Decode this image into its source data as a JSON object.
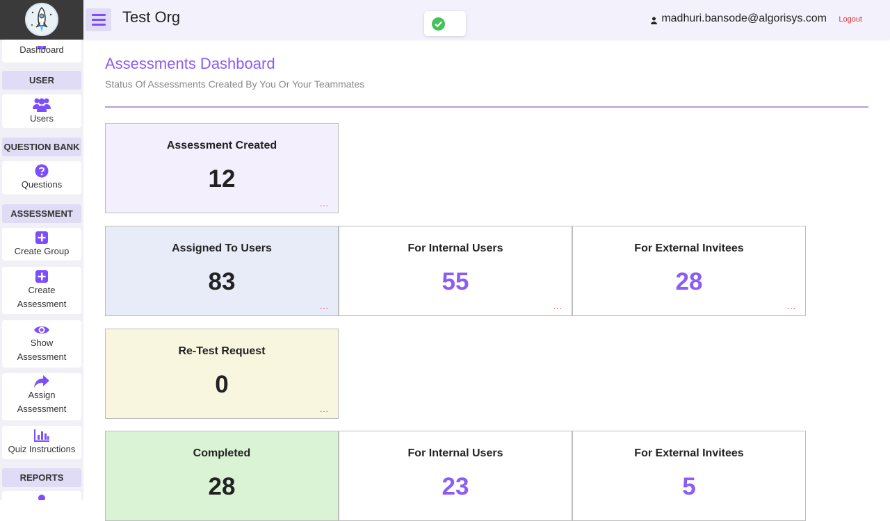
{
  "header": {
    "org_name": "Test Org",
    "user_email": "madhuri.bansode@algorisys.com",
    "logout_label": "Logout"
  },
  "sidebar": {
    "dashboard": "Dashboard",
    "section_user": "USER",
    "users": "Users",
    "section_question_bank": "QUESTION BANK",
    "questions": "Questions",
    "section_assessment": "ASSESSMENT",
    "create_group": "Create Group",
    "create_assessment_line1": "Create",
    "create_assessment_line2": "Assessment",
    "show_assessment_line1": "Show",
    "show_assessment_line2": "Assessment",
    "assign_assessment_line1": "Assign",
    "assign_assessment_line2": "Assessment",
    "quiz_instructions": "Quiz Instructions",
    "section_reports": "REPORTS"
  },
  "main": {
    "title": "Assessments Dashboard",
    "subtitle": "Status Of Assessments Created By You Or Your Teammates"
  },
  "cards": {
    "created": {
      "title": "Assessment Created",
      "value": "12",
      "more": "..."
    },
    "assigned": {
      "title": "Assigned To Users",
      "value": "83",
      "more": "..."
    },
    "assigned_internal": {
      "title": "For Internal Users",
      "value": "55",
      "more": "..."
    },
    "assigned_external": {
      "title": "For External Invitees",
      "value": "28",
      "more": "..."
    },
    "retest": {
      "title": "Re-Test Request",
      "value": "0",
      "more": "..."
    },
    "completed": {
      "title": "Completed",
      "value": "28"
    },
    "completed_internal": {
      "title": "For Internal Users",
      "value": "23"
    },
    "completed_external": {
      "title": "For External Invitees",
      "value": "5"
    }
  },
  "colors": {
    "accent": "#8b5cf6",
    "card_created_bg": "#f3effd",
    "card_assigned_bg": "#e7ecf8",
    "card_retest_bg": "#f8f6df",
    "card_completed_bg": "#dbf3d5",
    "logout": "#dd3333"
  },
  "icons": {
    "menu": "hamburger-icon",
    "user": "user-icon",
    "toast": "check-circle-icon"
  }
}
